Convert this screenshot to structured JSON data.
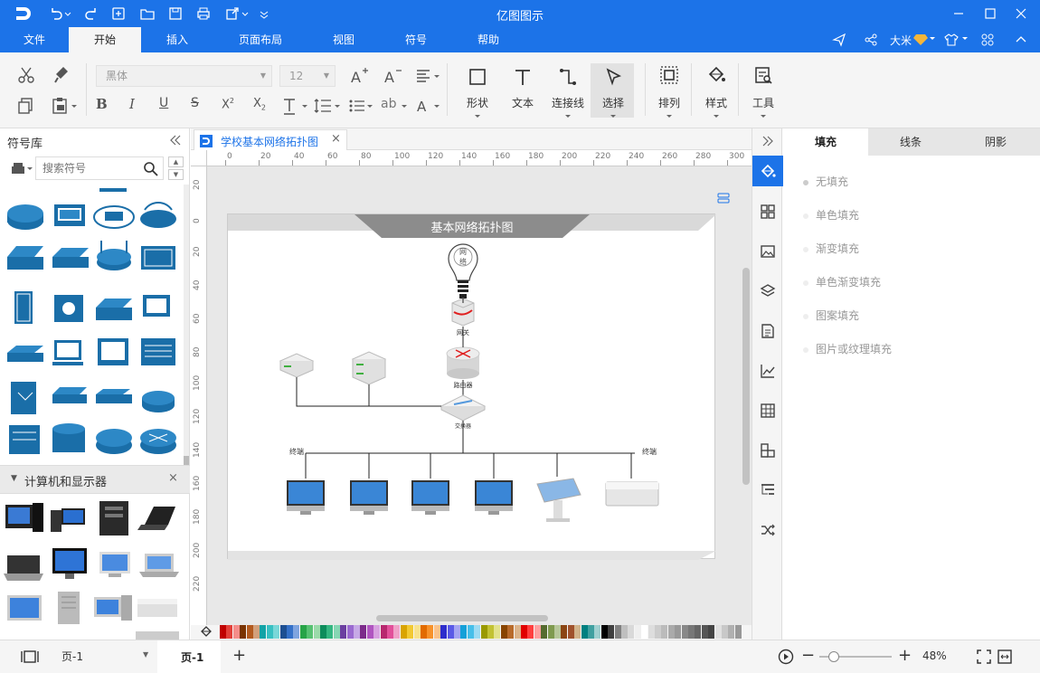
{
  "app": {
    "title": "亿图图示",
    "user": "大米"
  },
  "menu": {
    "tabs": [
      "文件",
      "开始",
      "插入",
      "页面布局",
      "视图",
      "符号",
      "帮助"
    ],
    "active_index": 1
  },
  "ribbon": {
    "font_name": "黑体",
    "font_size": "12",
    "big_buttons": [
      "形状",
      "文本",
      "连接线",
      "选择",
      "排列",
      "样式",
      "工具"
    ]
  },
  "library": {
    "title": "符号库",
    "search_placeholder": "搜索符号",
    "section2_title": "计算机和显示器"
  },
  "document": {
    "tab_title": "学校基本网络拓扑图"
  },
  "diagram": {
    "title": "基本网络拓扑图",
    "bulb_label_1": "网",
    "bulb_label_2": "络",
    "gateway_label": "网关",
    "router_label": "路由器",
    "switch_label": "交换器",
    "terminal_left": "终端",
    "terminal_right": "终端"
  },
  "ruler": {
    "h": [
      "0",
      "20",
      "40",
      "60",
      "80",
      "100",
      "120",
      "140",
      "160",
      "180",
      "200",
      "220",
      "240",
      "260",
      "280",
      "300"
    ],
    "v": [
      "20",
      "0",
      "20",
      "40",
      "60",
      "80",
      "100",
      "120",
      "140",
      "160",
      "180",
      "200",
      "220"
    ]
  },
  "fill_panel": {
    "tabs": [
      "填充",
      "线条",
      "阴影"
    ],
    "active_index": 0,
    "options": [
      "无填充",
      "单色填充",
      "渐变填充",
      "单色渐变填充",
      "图案填充",
      "图片或纹理填充"
    ]
  },
  "status": {
    "page_select": "页-1",
    "page_tab": "页-1",
    "zoom": "48%",
    "zoom_fraction": 0.48
  },
  "colors": {
    "brand": "#1c73e8",
    "network_blue": "#1a6ea8"
  }
}
